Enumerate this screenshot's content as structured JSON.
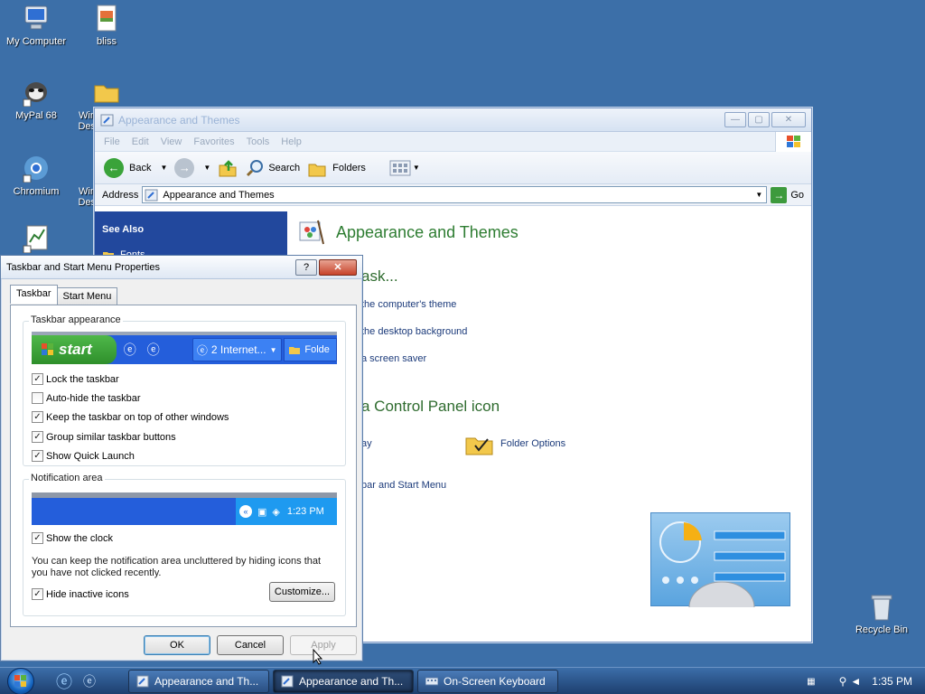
{
  "desktop": {
    "icons": [
      {
        "label": "My Computer"
      },
      {
        "label": "bliss"
      },
      {
        "label": "MyPal 68"
      },
      {
        "label": "Win Des"
      },
      {
        "label": "Chromium"
      },
      {
        "label": "Win Des"
      }
    ],
    "recycle_bin": "Recycle Bin"
  },
  "explorer": {
    "title": "Appearance and Themes",
    "menu": [
      "File",
      "Edit",
      "View",
      "Favorites",
      "Tools",
      "Help"
    ],
    "toolbar": {
      "back": "Back",
      "search": "Search",
      "folders": "Folders"
    },
    "address_label": "Address",
    "address_value": "Appearance and Themes",
    "go_label": "Go",
    "side": {
      "see_also": "See Also",
      "fonts": "Fonts"
    },
    "heading": "Appearance and Themes",
    "task_heading": "ask...",
    "tasks": [
      "the computer's theme",
      "the desktop background",
      "a screen saver"
    ],
    "cp_heading": "a Control Panel icon",
    "cp_items": [
      "ay",
      "bar and Start Menu"
    ],
    "folder_options": "Folder Options"
  },
  "dialog": {
    "title": "Taskbar and Start Menu Properties",
    "help_btn": "?",
    "close_btn": "✕",
    "tabs": [
      "Taskbar",
      "Start Menu"
    ],
    "appearance_group": "Taskbar appearance",
    "preview": {
      "start": "start",
      "task1": "2 Internet...",
      "task2": "Folde"
    },
    "checkboxes": [
      {
        "label": "Lock the taskbar",
        "checked": true
      },
      {
        "label": "Auto-hide the taskbar",
        "checked": false
      },
      {
        "label": "Keep the taskbar on top of other windows",
        "checked": true
      },
      {
        "label": "Group similar taskbar buttons",
        "checked": true
      },
      {
        "label": "Show Quick Launch",
        "checked": true
      }
    ],
    "notification_group": "Notification area",
    "tray_time": "1:23 PM",
    "show_clock": {
      "label": "Show the clock",
      "checked": true
    },
    "note": "You can keep the notification area uncluttered by hiding icons that you have not clicked recently.",
    "hide_inactive": {
      "label": "Hide inactive icons",
      "checked": true
    },
    "customize": "Customize...",
    "ok": "OK",
    "cancel": "Cancel",
    "apply": "Apply"
  },
  "taskbar": {
    "tasks": [
      "Appearance and Th...",
      "Appearance and Th...",
      "On-Screen Keyboard"
    ],
    "clock": "1:35 PM"
  }
}
